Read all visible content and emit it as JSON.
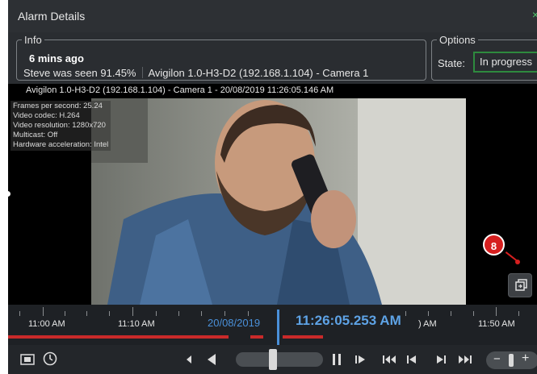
{
  "window": {
    "title": "Alarm Details",
    "close_glyph": "×"
  },
  "info": {
    "legend": "Info",
    "time_ago": "6 mins  ago",
    "seen_text": "Steve was seen 91.45%",
    "camera_text": "Avigilon 1.0-H3-D2 (192.168.1.104) - Camera 1"
  },
  "options": {
    "legend": "Options",
    "state_label": "State:",
    "state_value": "In progress"
  },
  "video": {
    "camera_title": "Avigilon 1.0-H3-D2 (192.168.1.104) - Camera 1 - 20/08/2019 11:26:05.146 AM",
    "stats": {
      "fps": "Frames per second: 25.24",
      "codec": "Video codec: H.264",
      "resolution": "Video resolution: 1280x720",
      "multicast": "Multicast: Off",
      "hw": "Hardware acceleration: Intel"
    },
    "callout_number": "8",
    "export_icon": "export-clip-icon"
  },
  "timeline": {
    "labels": [
      "11:00 AM",
      "11:10 AM",
      "11:50 AM"
    ],
    "date": "20/08/2019",
    "current_time": "11:26:05.253 AM",
    "partial_label": ") AM"
  },
  "colors": {
    "accent": "#4a90d9",
    "alarm_red": "#c92a2a",
    "state_border": "#2e8a3e",
    "background": "#2a2d31"
  }
}
